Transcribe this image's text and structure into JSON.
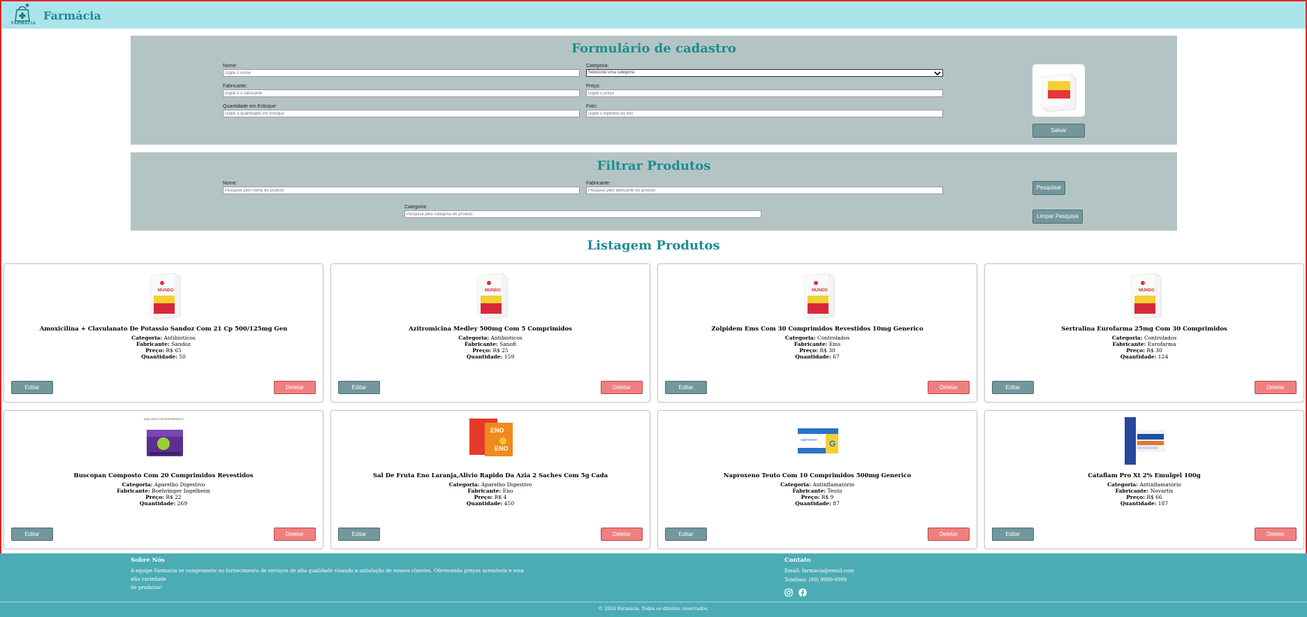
{
  "header": {
    "brand": "Farmácia",
    "logo_text": "FARMÁCIA",
    "logo_icon": "pharmacy-bag-icon"
  },
  "form": {
    "title": "Formulário de cadastro",
    "nome_label": "Nome:",
    "nome_placeholder": "Digite o nome",
    "categoria_label": "Categoria:",
    "categoria_selected": "Selecione uma categoria",
    "fabricante_label": "Fabricante:",
    "fabricante_placeholder": "Digite o o fabricante",
    "preco_label": "Preço:",
    "preco_placeholder": "Digite o preço",
    "quantidade_label": "Quantidade em Estoque:",
    "quantidade_placeholder": "Digite a quantidade em estoque",
    "foto_label": "Foto:",
    "foto_placeholder": "Digite o hiperlink da foto",
    "save_label": "Salvar"
  },
  "filter": {
    "title": "Filtrar Produtos",
    "nome_label": "Nome:",
    "nome_placeholder": "Pesquise pelo nome do produto",
    "fabricante_label": "Fabricante:",
    "fabricante_placeholder": "Pesquise pelo fabricante do produto",
    "categoria_label": "Categoria:",
    "categoria_placeholder": "Pesquise pela categoria do produto",
    "search_label": "Pesquisar",
    "clear_label": "Limpar Pesquisa"
  },
  "listing": {
    "title": "Listagem Produtos",
    "categoria_key": "Categoria:",
    "fabricante_key": "Fabricante:",
    "preco_key": "Preço:",
    "quantidade_key": "Quantidade:",
    "edit_label": "Editar",
    "delete_label": "Deletar",
    "products": [
      {
        "name": "Amoxicilina + Clavulanato De Potassio Sandoz Com 21 Cp 500/125mg Gen",
        "categoria": "Antibioticos",
        "fabricante": "Sandoz",
        "preco": "R$ 65",
        "quantidade": "50",
        "image": "generic-box"
      },
      {
        "name": "Azitromicina Medley 500mg Com 5 Comprimidos",
        "categoria": "Antibioticos",
        "fabricante": "Sanofi",
        "preco": "R$ 25",
        "quantidade": "159",
        "image": "generic-box"
      },
      {
        "name": "Zolpidem Ems Com 30 Comprimidos Revestidos 10mg Generico",
        "categoria": "Controlados",
        "fabricante": "Ems",
        "preco": "R$ 30",
        "quantidade": "67",
        "image": "generic-box"
      },
      {
        "name": "Sertralina Eurofarma 25mg Com 30 Comprimidos",
        "categoria": "Controlados",
        "fabricante": "Eurofarma",
        "preco": "R$ 30",
        "quantidade": "124",
        "image": "generic-box"
      },
      {
        "name": "Buscopan Composto Com 20 Comprimidos Revestidos",
        "categoria": "Aparelho Digestivo",
        "fabricante": "Boehringer Ingelheim",
        "preco": "R$ 22",
        "quantidade": "269",
        "image": "purple-box"
      },
      {
        "name": "Sal De Fruta Eno Laranja,Alivio Rapido Da Azia 2 Saches Com 5g Cada",
        "categoria": "Aparelho Digestivo",
        "fabricante": "Eno",
        "preco": "R$ 4",
        "quantidade": "450",
        "image": "orange-sachet"
      },
      {
        "name": "Naproxeno Teuto Com 10 Comprimidos 500mg Generico",
        "categoria": "Antinflamatório",
        "fabricante": "Teuto",
        "preco": "R$ 9",
        "quantidade": "87",
        "image": "blue-box"
      },
      {
        "name": "Cataflam Pro Xt 2% Emulgel 100g",
        "categoria": "Antinflamatório",
        "fabricante": "Novartis",
        "preco": "R$ 66",
        "quantidade": "187",
        "image": "tube-box"
      }
    ]
  },
  "footer": {
    "about_title": "Sobre Nós",
    "about_text_1": "A equipe Farmacia se compromete no fornecimento de serviços de alta qualidade visando a satisfação de nossos clientes. Oferecendo preços acessíveis e uma alta variedade",
    "about_text_2": "de produtos!",
    "contact_title": "Contato",
    "email": "Email: farmacia@email.com",
    "phone": "Telefone: (99) 9999-9999",
    "icons": [
      "instagram-icon",
      "facebook-icon"
    ],
    "copyright": "© 2024 Farmácia. Todos os direitos reservados."
  },
  "colors": {
    "header_bg": "#ace4ec",
    "panel_bg": "#b4c4c4",
    "accent": "#1d8c93",
    "footer_bg": "#4cacb5",
    "edit_btn": "#72979c",
    "delete_btn": "#f08080"
  }
}
